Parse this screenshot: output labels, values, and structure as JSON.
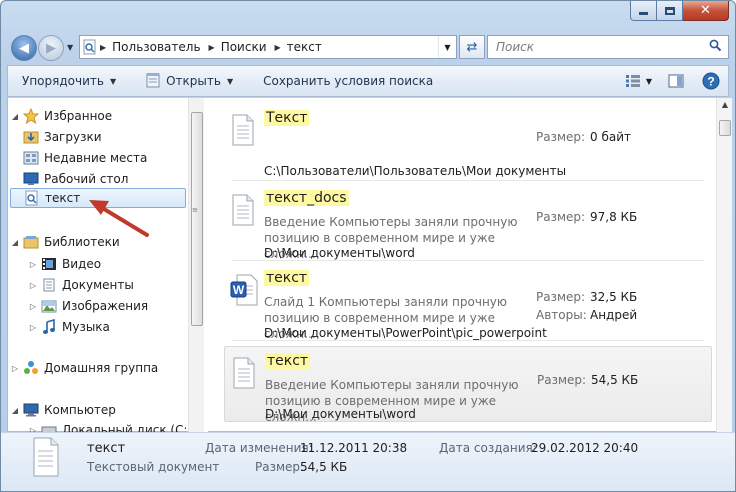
{
  "address": {
    "crumbs": [
      "Пользователь",
      "Поиски",
      "текст"
    ]
  },
  "search": {
    "placeholder": "Поиск"
  },
  "toolbar": {
    "organize": "Упорядочить",
    "open": "Открыть",
    "save_search": "Сохранить условия поиска"
  },
  "nav": {
    "favorites": "Избранное",
    "downloads": "Загрузки",
    "recent": "Недавние места",
    "desktop": "Рабочий стол",
    "search_text": "текст",
    "libraries": "Библиотеки",
    "video": "Видео",
    "documents": "Документы",
    "pictures": "Изображения",
    "music": "Музыка",
    "homegroup": "Домашняя группа",
    "computer": "Компьютер",
    "local_disk": "Локальный диск (C:)"
  },
  "results": [
    {
      "name": "Текст",
      "snippet": "",
      "path": "C:\\Пользователи\\Пользователь\\Мои документы",
      "size_label": "Размер:",
      "size": "0 байт",
      "author_label": "",
      "author": "",
      "icon": "text-file-icon"
    },
    {
      "name": "текст_docs",
      "snippet": "Введение Компьютеры заняли прочную позицию в современном мире и уже сложн...",
      "path": "D:\\Мои документы\\word",
      "size_label": "Размер:",
      "size": "97,8 КБ",
      "author_label": "",
      "author": "",
      "icon": "text-file-icon"
    },
    {
      "name": "текст",
      "snippet": "Слайд 1 Компьютеры заняли прочную позицию в современном мире и уже сложн...",
      "path": "D:\\Мои документы\\PowerPoint\\pic_powerpoint",
      "size_label": "Размер:",
      "size": "32,5 КБ",
      "author_label": "Авторы:",
      "author": "Андрей",
      "icon": "word-document-icon"
    },
    {
      "name": "текст",
      "snippet": "Введение Компьютеры заняли прочную позицию в современном мире и уже сложн...",
      "path": "D:\\Мои документы\\word",
      "size_label": "Размер:",
      "size": "54,5 КБ",
      "author_label": "",
      "author": "",
      "icon": "text-file-icon"
    }
  ],
  "details": {
    "name": "текст",
    "type": "Текстовый документ",
    "modified_label": "Дата изменения:",
    "modified": "11.12.2011 20:38",
    "size_label": "Размер:",
    "size": "54,5 КБ",
    "created_label": "Дата создания:",
    "created": "29.02.2012 20:40"
  },
  "colors": {
    "highlight": "#fff8a3",
    "selection_border": "#84acdd",
    "annotation_arrow": "#c0392b"
  }
}
